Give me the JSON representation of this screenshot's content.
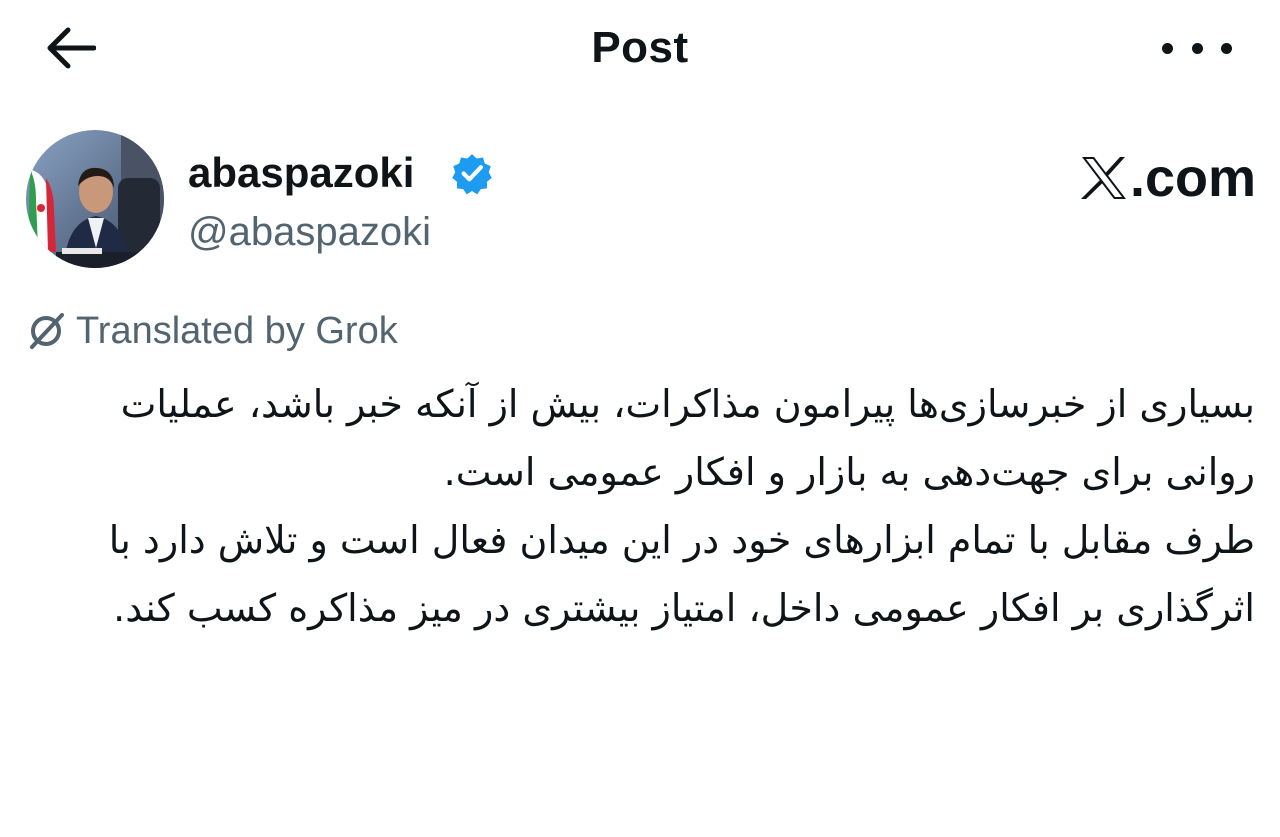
{
  "header": {
    "title": "Post",
    "back_icon": "arrow-left-icon",
    "more_icon": "more-horizontal-icon"
  },
  "author": {
    "display_name": "abaspazoki",
    "handle": "@abaspazoki",
    "verified": true,
    "verified_color": "#1d9bf0"
  },
  "site_mark": {
    "text": ".com",
    "logo_icon": "x-logo-icon"
  },
  "translation": {
    "label": "Translated by Grok",
    "icon": "grok-icon"
  },
  "post": {
    "paragraphs": [
      "بسیاری از خبرسازی‌ها پیرامون مذاکرات، بیش از آنکه خبر باشد، عملیات روانی برای جهت‌دهی به بازار و افکار عمومی است.",
      "طرف مقابل با تمام ابزارهای خود در این میدان فعال است و تلاش دارد با اثرگذاری بر افکار عمومی داخل، امتیاز بیشتری در میز مذاکره کسب کند."
    ]
  },
  "colors": {
    "text_primary": "#0f1419",
    "text_secondary": "#536471",
    "accent": "#1d9bf0"
  }
}
